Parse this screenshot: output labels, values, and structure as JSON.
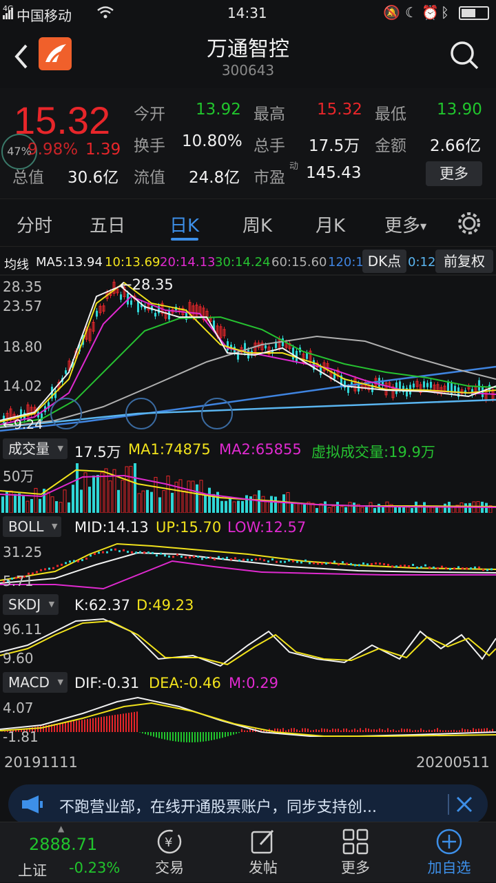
{
  "status": {
    "carrier": "中国移动",
    "time": "14:31",
    "net": "4G"
  },
  "header": {
    "title": "万通智控",
    "code": "300643"
  },
  "quote": {
    "price": "15.32",
    "change_pct": "9.98%",
    "change": "1.39",
    "pct_badge": "47%",
    "open_label": "今开",
    "open": "13.92",
    "high_label": "最高",
    "high": "15.32",
    "low_label": "最低",
    "low": "13.90",
    "turnover_label": "换手",
    "turnover": "10.80%",
    "volume_label": "总手",
    "volume": "17.5万",
    "amount_label": "金额",
    "amount": "2.66亿",
    "mktcap_label": "总值",
    "mktcap": "30.6亿",
    "float_label": "流值",
    "float": "24.8亿",
    "pe_label": "市盈",
    "pe_sup": "动",
    "pe": "145.43",
    "more_label": "更多"
  },
  "tabs": [
    "分时",
    "五日",
    "日K",
    "周K",
    "月K",
    "更多"
  ],
  "ma": {
    "label": "均线",
    "ma5": "MA5:13.94",
    "ma10": "10:13.69",
    "ma20": "20:14.13",
    "ma30": "30:14.24",
    "ma60": "60:15.60",
    "ma120": "120:1",
    "ma_tail": "0:12.",
    "dk_label": "DK点",
    "fq_label": "前复权"
  },
  "kline": {
    "y_labels": [
      "28.35",
      "23.57",
      "18.80",
      "14.02"
    ],
    "max_note": "←28.35",
    "min_note": "←9.24"
  },
  "volume": {
    "btn": "成交量",
    "value": "17.5万",
    "ma1": "MA1:74875",
    "ma2": "MA2:65855",
    "virtual": "虚拟成交量:19.9万",
    "y_label": "50万"
  },
  "boll": {
    "btn": "BOLL",
    "mid": "MID:14.13",
    "up": "UP:15.70",
    "low": "LOW:12.57",
    "y_top": "31.25",
    "y_bottom": "5.71"
  },
  "skdj": {
    "btn": "SKDJ",
    "k": "K:62.37",
    "d": "D:49.23",
    "y_top": "96.11",
    "y_bottom": "9.60"
  },
  "macd": {
    "btn": "MACD",
    "dif": "DIF:-0.31",
    "dea": "DEA:-0.46",
    "m": "M:0.29",
    "y_top": "4.07",
    "y_bottom": "-1.81"
  },
  "dates": {
    "start": "20191111",
    "end": "20200511"
  },
  "banner": {
    "text": "不跑营业部，在线开通股票账户，同步支持创..."
  },
  "nav": {
    "index_value": "2888.71",
    "index_name": "上证",
    "index_change": "-0.23%",
    "trade": "交易",
    "post": "发帖",
    "more": "更多",
    "add": "加自选"
  },
  "colors": {
    "up": "#e8262a",
    "down": "#21c52d",
    "accent": "#3d8fe8"
  }
}
